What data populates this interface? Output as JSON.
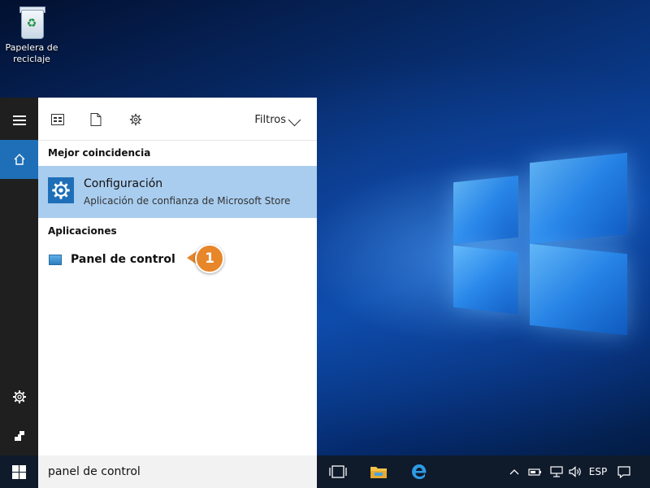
{
  "desktop": {
    "recycle_bin_label": "Papelera de reciclaje"
  },
  "start_menu": {
    "rail": {
      "items": [
        {
          "name": "hamburger-menu-icon"
        },
        {
          "name": "home-icon",
          "active": true
        },
        {
          "name": "gear-icon"
        },
        {
          "name": "user-feedback-icon"
        }
      ]
    },
    "toolbar": {
      "icons": [
        "apps-view-icon",
        "documents-icon",
        "settings-icon"
      ],
      "filters_label": "Filtros"
    },
    "best_match": {
      "heading": "Mejor coincidencia",
      "title": "Configuración",
      "subtitle": "Aplicación de confianza de Microsoft Store",
      "icon": "gear-icon"
    },
    "apps": {
      "heading": "Aplicaciones",
      "items": [
        {
          "label": "Panel de control",
          "icon": "control-panel-icon"
        }
      ]
    },
    "callout": {
      "number": "1",
      "color": "#e8862a"
    }
  },
  "taskbar": {
    "search_value": "panel de control",
    "apps": [
      "task-view-icon",
      "file-explorer-icon",
      "edge-icon"
    ],
    "tray": {
      "language": "ESP"
    }
  },
  "colors": {
    "accent": "#1f6fb8",
    "selection": "#a9cdef",
    "taskbar": "#0f1a2b",
    "rail": "#1f1f1f"
  }
}
